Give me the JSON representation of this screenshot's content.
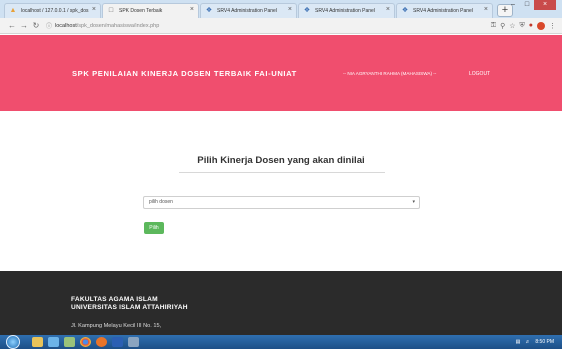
{
  "browser": {
    "tabs": [
      {
        "label": "localhost / 127.0.0.1 / spk_dos",
        "icon": "phpmyadmin-icon",
        "active": false
      },
      {
        "label": "SPK Dosen Terbaik",
        "icon": "page-icon",
        "active": true
      },
      {
        "label": "SRV4 Administration Panel",
        "icon": "srv-icon",
        "active": false
      },
      {
        "label": "SRV4 Administration Panel",
        "icon": "srv-icon",
        "active": false
      },
      {
        "label": "SRV4 Administration Panel",
        "icon": "srv-icon",
        "active": false
      }
    ],
    "url_host": "localhost",
    "url_path": "/spk_dosen/mahasiswa/index.php"
  },
  "header": {
    "brand": "SPK PENILAIAN KINERJA DOSEN TERBAIK FAI-UNIAT",
    "user": "-- NIA AGRYANTHI RAHMA (MAHASISWA) --",
    "logout": "LOGOUT"
  },
  "main": {
    "title": "Pilih Kinerja Dosen yang akan dinilai",
    "select_value": "pilih dosen",
    "submit_label": "Pilih"
  },
  "footer": {
    "line1": "FAKULTAS AGAMA ISLAM",
    "line2": "UNIVERSITAS ISLAM ATTAHIRIYAH",
    "address": "Jl. Kampung Melayu Kecil III No. 15,"
  },
  "taskbar": {
    "clock": "8:50 PM"
  },
  "colors": {
    "header_bg": "#f04e6e",
    "footer_bg": "#2b2b2b",
    "button_green": "#5cb85c"
  }
}
